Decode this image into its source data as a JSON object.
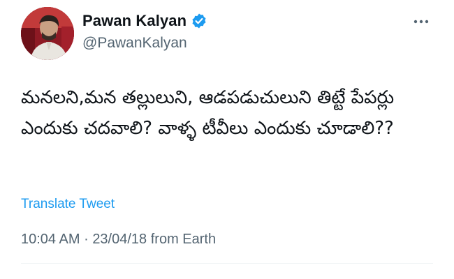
{
  "author": {
    "display_name": "Pawan Kalyan",
    "handle": "@PawanKalyan",
    "verified": true,
    "avatar_icon": "profile-photo"
  },
  "menu": {
    "icon": "more-horizontal-icon"
  },
  "tweet": {
    "text": "మనలని,మన తల్లులుని, ఆడపడుచులుని తిట్టే పేపర్లు ఎందుకు చదవాలి? వాళ్ళ టీవీలు ఎందుకు చూడాలి??"
  },
  "actions": {
    "translate_label": "Translate Tweet"
  },
  "meta": {
    "time": "10:04 AM",
    "separator": "·",
    "date": "23/04/18",
    "source": "from Earth"
  },
  "colors": {
    "accent": "#1d9bf0",
    "secondary_text": "#536471",
    "primary_text": "#0f1419",
    "divider": "#eff3f4"
  }
}
